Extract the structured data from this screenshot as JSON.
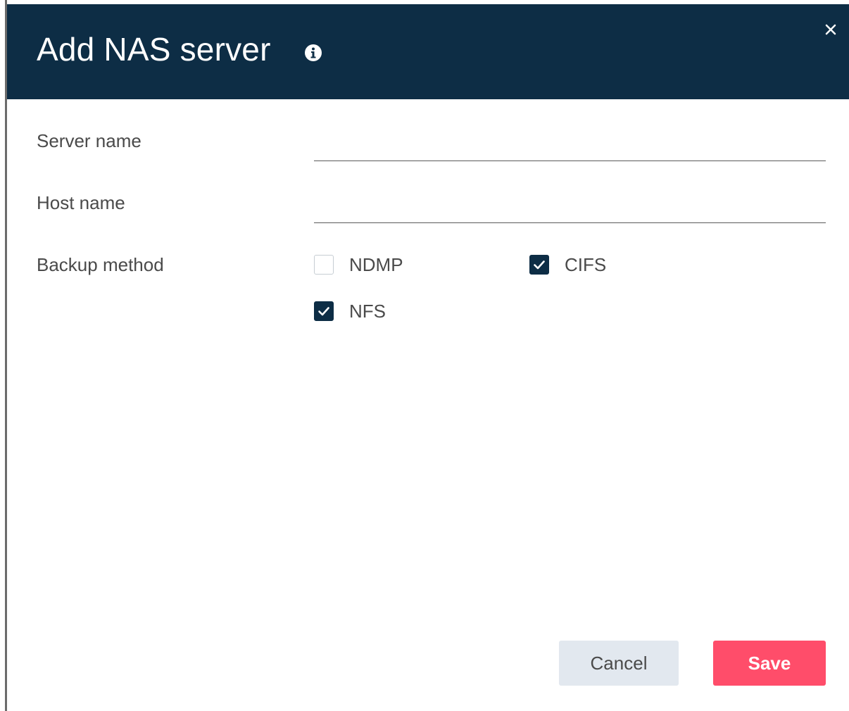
{
  "dialog": {
    "title": "Add NAS server",
    "info_icon": "info-circle-icon",
    "close_icon": "close-icon"
  },
  "form": {
    "server_name": {
      "label": "Server name",
      "value": "",
      "placeholder": ""
    },
    "host_name": {
      "label": "Host name",
      "value": "",
      "placeholder": ""
    },
    "backup_method": {
      "label": "Backup method",
      "options": [
        {
          "label": "NDMP",
          "checked": false
        },
        {
          "label": "CIFS",
          "checked": true
        },
        {
          "label": "NFS",
          "checked": true
        }
      ]
    }
  },
  "footer": {
    "cancel_label": "Cancel",
    "save_label": "Save"
  },
  "colors": {
    "header_bg": "#0d2d45",
    "primary_button": "#ff4d6a",
    "secondary_button": "#e2e8ef",
    "checkbox_checked": "#0d2d45"
  }
}
